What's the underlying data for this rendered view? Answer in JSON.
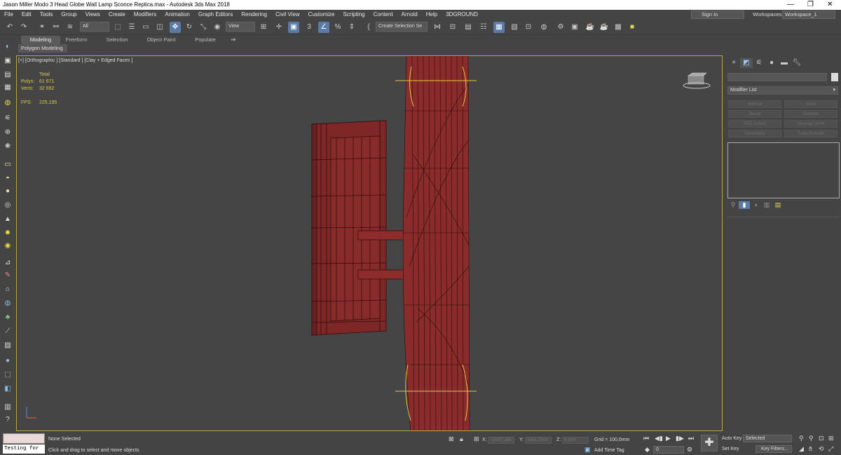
{
  "window": {
    "title": "Jason Miller Modo 3 Head Globe Wall Lamp Sconce Replica.max - Autodesk 3ds Max 2018",
    "controls": [
      "—",
      "❐",
      "✕"
    ]
  },
  "menu": {
    "items": [
      "File",
      "Edit",
      "Tools",
      "Group",
      "Views",
      "Create",
      "Modifiers",
      "Animation",
      "Graph Editors",
      "Rendering",
      "Civil View",
      "Customize",
      "Scripting",
      "Content",
      "Arnold",
      "Help",
      "3DGROUND"
    ],
    "sign_in": "Sign In",
    "workspaces_label": "Workspaces:",
    "workspace_value": "Workspace_1"
  },
  "toolbar": {
    "filter": "All",
    "ref_coord": "View",
    "selection_set": "Create Selection Se",
    "snap_label": "3"
  },
  "ribbon": {
    "tabs": [
      "Modeling",
      "Freeform",
      "Selection",
      "Object Paint",
      "Populate"
    ],
    "active": "Modeling",
    "subtab": "Polygon Modeling"
  },
  "viewport": {
    "label": "[+] [Orthographic ] [Standard ] [Clay + Edged Faces ]",
    "stats": {
      "total": "Total",
      "polys_label": "Polys:",
      "polys": "61 671",
      "verts_label": "Verts:",
      "verts": "32 692",
      "fps_label": "FPS:",
      "fps": "225,195"
    }
  },
  "command_panel": {
    "modifier_list": "Modifier List",
    "buttons": [
      "Normal",
      "Shell",
      "Bend",
      "Smooth",
      "FFD 2x2x2",
      "Unwrap UVW",
      "Symmetry",
      "TurboSmooth"
    ]
  },
  "status": {
    "listener": "Testing for :",
    "selection": "None Selected",
    "prompt": "Click and drag to select and move objects",
    "x_label": "X:",
    "x_value": "-10357,165",
    "y_label": "Y:",
    "y_value": "1041,72cm",
    "z_label": "Z:",
    "z_value": "0,0cm",
    "grid": "Grid = 100,0mm",
    "add_time_tag": "Add Time Tag",
    "frame": "0",
    "auto_key": "Auto Key",
    "set_key": "Set Key",
    "selected": "Selected",
    "key_filters": "Key Filters..."
  },
  "colors": {
    "model": "#8a2a2a",
    "viewport_border": "#b8a43a",
    "stats": "#d8c84a",
    "active_tool": "#5a7aa8"
  }
}
